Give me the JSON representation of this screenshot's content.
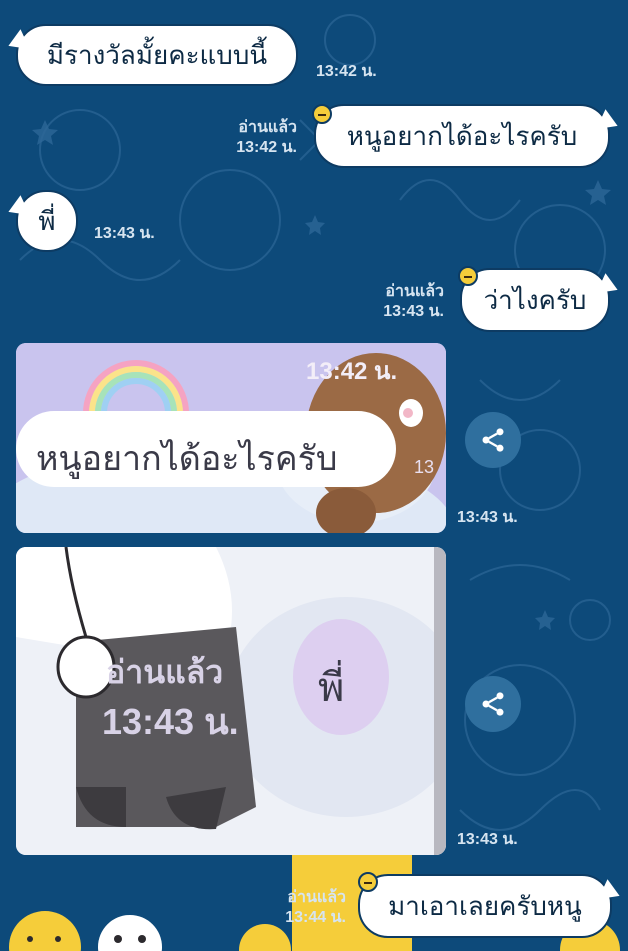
{
  "colors": {
    "background": "#0d4a7a",
    "bubble": "#ffffff",
    "meta_text": "#d6e4f0",
    "share_button": "#2f6f9e"
  },
  "messages": [
    {
      "side": "left",
      "text": "มีรางวัลมั้ยคะแบบนี้",
      "time": "13:42 น."
    },
    {
      "side": "right",
      "text": "หนูอยากได้อะไรครับ",
      "read": "อ่านแล้ว",
      "time": "13:42 น."
    },
    {
      "side": "left",
      "text": "พี่",
      "time": "13:43 น."
    },
    {
      "side": "right",
      "text": "ว่าไงครับ",
      "read": "อ่านแล้ว",
      "time": "13:43 น."
    },
    {
      "side": "left",
      "type": "image",
      "time": "13:43 น.",
      "image_text": {
        "bubble": "หนูอยากได้อะไรครับ",
        "time": "13:42 น.",
        "clip": "13"
      }
    },
    {
      "side": "left",
      "type": "image",
      "time": "13:43 น.",
      "image_text": {
        "read": "อ่านแล้ว",
        "time": "13:43 น.",
        "bubble": "พี่"
      }
    },
    {
      "side": "right",
      "text": "มาเอาเลยครับหนู",
      "read": "อ่านแล้ว",
      "time": "13:44 น."
    }
  ],
  "icons": {
    "share": "share-icon",
    "sticker": "smiley-sticker-icon"
  }
}
